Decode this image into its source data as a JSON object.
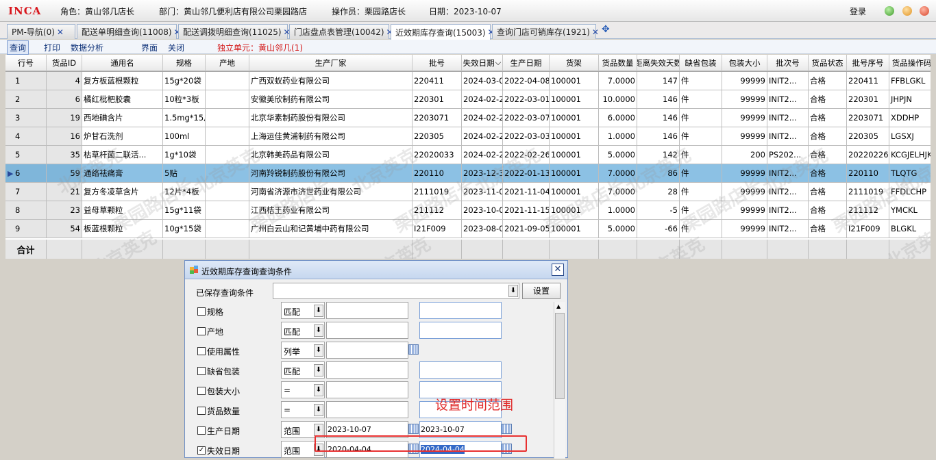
{
  "topbar": {
    "logo": "INCA",
    "role": "角色：黄山邻几店长",
    "dept": "部门：黄山邻几便利店有限公司栗园路店",
    "operator": "操作员：栗园路店长",
    "date": "日期：2023-10-07",
    "login": "登录"
  },
  "tabs": [
    {
      "label": "PM-导航(0)"
    },
    {
      "label": "配送单明细查询(11008)"
    },
    {
      "label": "配送调拨明细查询(11025)"
    },
    {
      "label": "门店盘点表管理(10042)"
    },
    {
      "label": "近效期库存查询(15003)"
    },
    {
      "label": "查询门店可销库存(1921)"
    }
  ],
  "toolbar": {
    "query": "查询",
    "print": "打印",
    "analysis": "数据分析",
    "ui": "界面",
    "close": "关闭",
    "unit": "独立单元：黄山邻几(1)"
  },
  "grid": {
    "headers": [
      "行号",
      "货品ID",
      "通用名",
      "规格",
      "产地",
      "生产厂家",
      "批号",
      "失效日期",
      "生产日期",
      "货架",
      "货品数量",
      "距离失效天数",
      "缺省包装",
      "包装大小",
      "批次号",
      "货品状态",
      "批号序号",
      "货品操作码"
    ],
    "rows": [
      [
        "1",
        "4",
        "复方板蓝根颗粒",
        "15g*20袋",
        "",
        "广西双蚁药业有限公司",
        "220411",
        "2024-03-01",
        "2022-04-08",
        "100001",
        "7.0000",
        "147",
        "件",
        "99999",
        "INIT2...",
        "合格",
        "220411",
        "FFBLGKL"
      ],
      [
        "2",
        "6",
        "橘红枇杷胶囊",
        "10粒*3板",
        "",
        "安徽美欣制药有限公司",
        "220301",
        "2024-02-29",
        "2022-03-01",
        "100001",
        "10.0000",
        "146",
        "件",
        "99999",
        "INIT2...",
        "合格",
        "220301",
        "JHPJN"
      ],
      [
        "3",
        "19",
        "西地碘含片",
        "1.5mg*15片",
        "",
        "北京华素制药股份有限公司",
        "2203071",
        "2024-02-29",
        "2022-03-07",
        "100001",
        "6.0000",
        "146",
        "件",
        "99999",
        "INIT2...",
        "合格",
        "2203071",
        "XDDHP"
      ],
      [
        "4",
        "16",
        "炉甘石洗剂",
        "100ml",
        "",
        "上海运佳黄浦制药有限公司",
        "220305",
        "2024-02-28",
        "2022-03-03",
        "100001",
        "1.0000",
        "146",
        "件",
        "99999",
        "INIT2...",
        "合格",
        "220305",
        "LGSXJ"
      ],
      [
        "5",
        "35",
        "枯草杆菌二联活...",
        "1g*10袋",
        "",
        "北京韩美药品有限公司",
        "22020033",
        "2024-02-25",
        "2022-02-26",
        "100001",
        "5.0000",
        "142",
        "件",
        "200",
        "PS202...",
        "合格",
        "20220226",
        "KCGJELHJKL"
      ],
      [
        "6",
        "59",
        "通络祛痛膏",
        "5贴",
        "",
        "河南羚锐制药股份有限公司",
        "220110",
        "2023-12-31",
        "2022-01-13",
        "100001",
        "7.0000",
        "86",
        "件",
        "99999",
        "INIT2...",
        "合格",
        "220110",
        "TLQTG"
      ],
      [
        "7",
        "21",
        "复方冬凌草含片",
        "12片*4板",
        "",
        "河南省济源市济世药业有限公司",
        "2111019",
        "2023-11-03",
        "2021-11-04",
        "100001",
        "7.0000",
        "28",
        "件",
        "99999",
        "INIT2...",
        "合格",
        "2111019",
        "FFDLCHP"
      ],
      [
        "8",
        "23",
        "益母草颗粒",
        "15g*11袋",
        "",
        "江西桔王药业有限公司",
        "211112",
        "2023-10-01",
        "2021-11-15",
        "100001",
        "1.0000",
        "-5",
        "件",
        "99999",
        "INIT2...",
        "合格",
        "211112",
        "YMCKL"
      ],
      [
        "9",
        "54",
        "板蓝根颗粒",
        "10g*15袋",
        "",
        "广州白云山和记黄埔中药有限公司",
        "I21F009",
        "2023-08-01",
        "2021-09-05",
        "100001",
        "5.0000",
        "-66",
        "件",
        "99999",
        "INIT2...",
        "合格",
        "I21F009",
        "BLGKL"
      ]
    ],
    "sum_label": "合计",
    "watermark_1": "北京英克",
    "watermark_2": "栗园路店长"
  },
  "dialog": {
    "title": "近效期库存查询查询条件",
    "saved_label": "已保存查询条件",
    "set_button": "设置",
    "note": "设置时间范围",
    "conditions": [
      {
        "label": "规格",
        "op": "匹配",
        "v1": "",
        "v2": "",
        "checked": false
      },
      {
        "label": "产地",
        "op": "匹配",
        "v1": "",
        "v2": "",
        "checked": false
      },
      {
        "label": "使用属性",
        "op": "列举",
        "v1": "",
        "v2": "",
        "checked": false
      },
      {
        "label": "缺省包装",
        "op": "匹配",
        "v1": "",
        "v2": "",
        "checked": false
      },
      {
        "label": "包装大小",
        "op": "=",
        "v1": "",
        "v2": "",
        "checked": false
      },
      {
        "label": "货品数量",
        "op": "=",
        "v1": "",
        "v2": "",
        "checked": false
      },
      {
        "label": "生产日期",
        "op": "范围",
        "v1": "2023-10-07",
        "v2": "2023-10-07",
        "checked": false
      },
      {
        "label": "失效日期",
        "op": "范围",
        "v1": "2020-04-04",
        "v2": "2024-04-04",
        "checked": true
      }
    ]
  }
}
